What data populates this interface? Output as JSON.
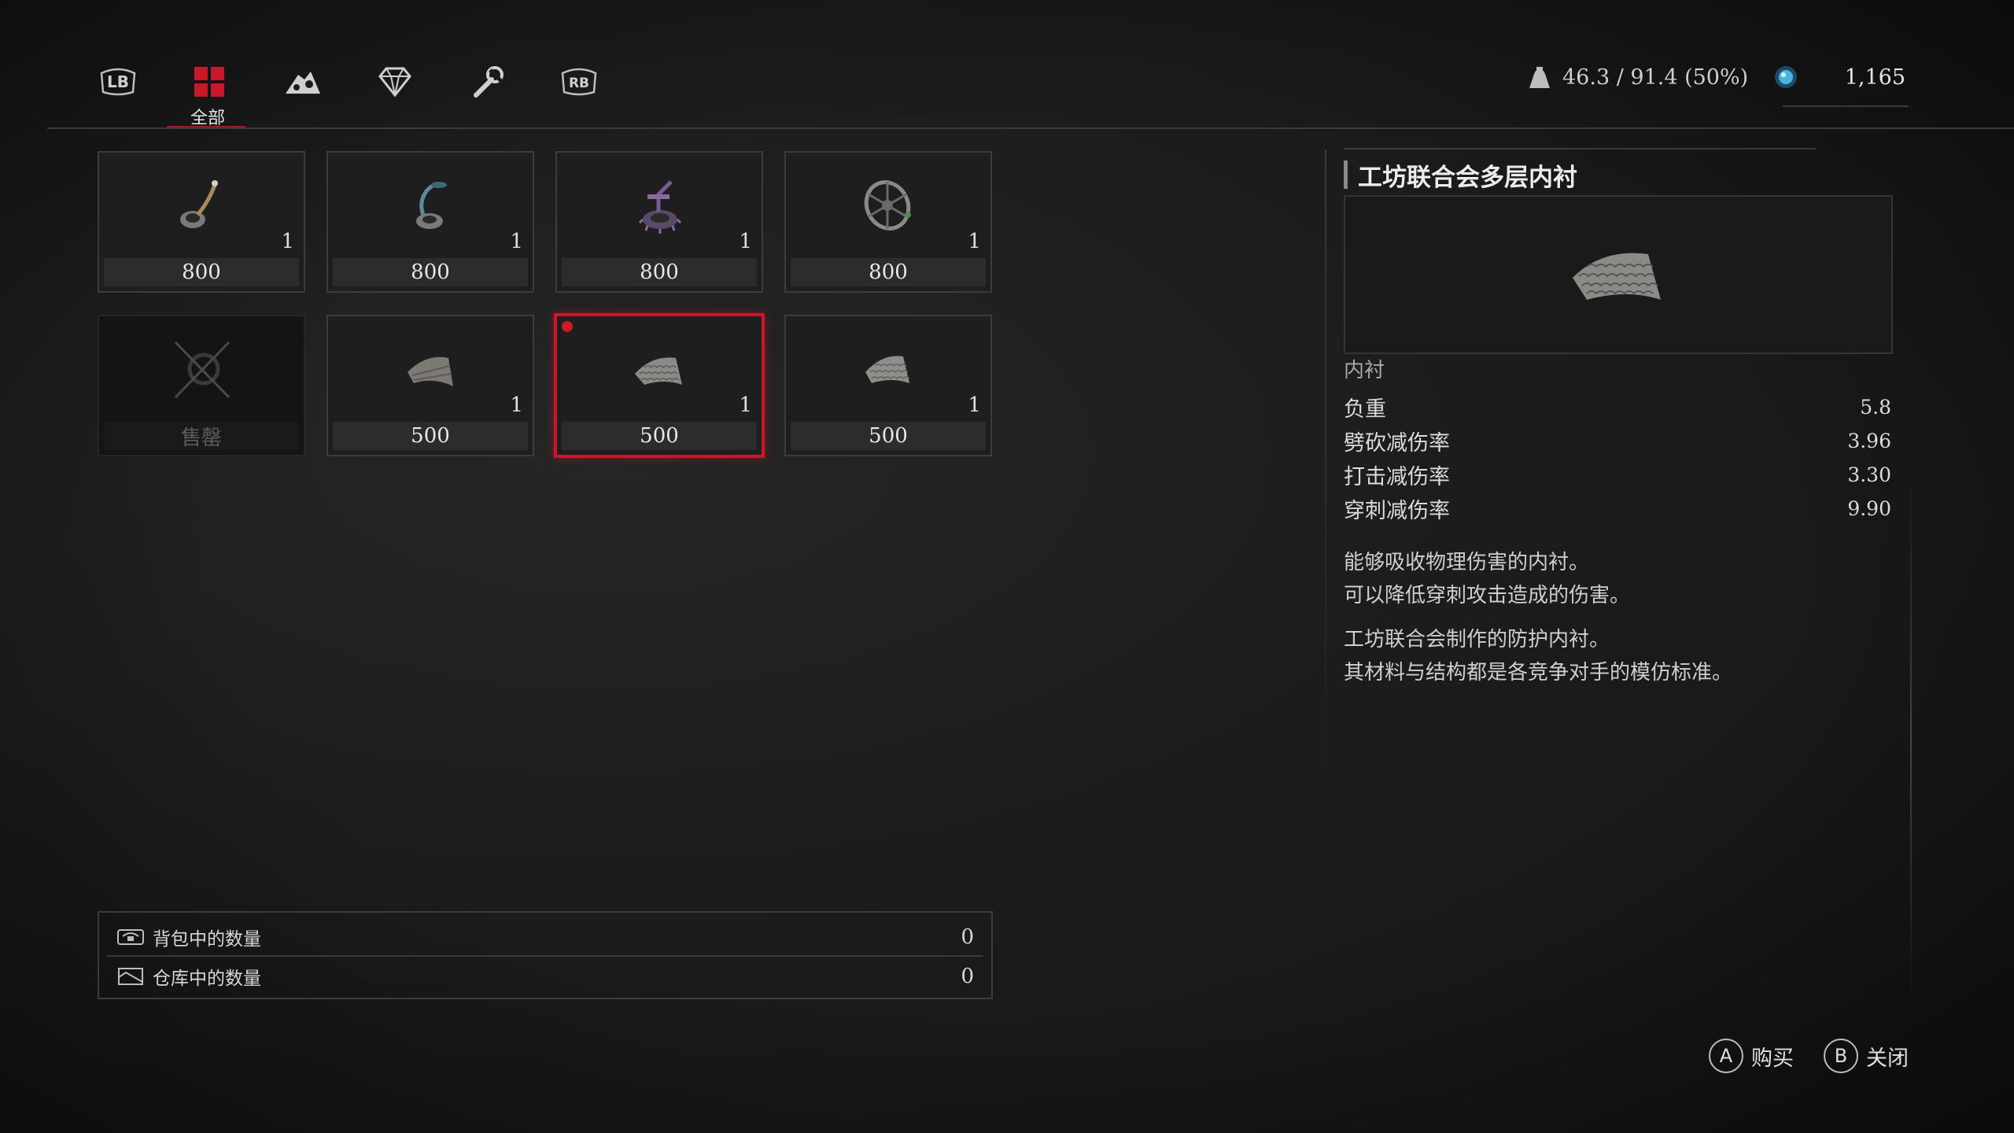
{
  "tabs": [
    {
      "name": "LB",
      "icon": "lb-shoulder-icon"
    },
    {
      "name": "全部",
      "icon": "all-grid-icon",
      "active": true
    },
    {
      "name": "",
      "icon": "cogs-pile-icon"
    },
    {
      "name": "",
      "icon": "gem-icon"
    },
    {
      "name": "",
      "icon": "wrench-icon"
    },
    {
      "name": "RB",
      "icon": "rb-shoulder-icon"
    }
  ],
  "header": {
    "weight_text": "46.3 / 91.4 (50%)",
    "currency_value": "1,165"
  },
  "items": [
    {
      "icon": "crank-amulet-icon",
      "qty": "1",
      "price": "800"
    },
    {
      "icon": "amulet-blue-icon",
      "qty": "1",
      "price": "800"
    },
    {
      "icon": "amulet-purple-gear-icon",
      "qty": "1",
      "price": "800"
    },
    {
      "icon": "wheel-amulet-icon",
      "qty": "1",
      "price": "800"
    },
    {
      "icon": "sold-out-icon",
      "qty": "",
      "price": "售罄",
      "sold": true
    },
    {
      "icon": "liner-plate-icon",
      "qty": "1",
      "price": "500"
    },
    {
      "icon": "liner-scale-icon",
      "qty": "1",
      "price": "500",
      "selected": true
    },
    {
      "icon": "liner-scale-icon",
      "qty": "1",
      "price": "500"
    }
  ],
  "counts": {
    "backpack_label": "背包中的数量",
    "backpack_value": "0",
    "storage_label": "仓库中的数量",
    "storage_value": "0"
  },
  "detail": {
    "title": "工坊联合会多层内衬",
    "category": "内衬",
    "stats": [
      {
        "label": "负重",
        "value": "5.8"
      },
      {
        "label": "劈砍减伤率",
        "value": "3.96"
      },
      {
        "label": "打击减伤率",
        "value": "3.30"
      },
      {
        "label": "穿刺减伤率",
        "value": "9.90"
      }
    ],
    "desc_1_line_1": "能够吸收物理伤害的内衬。",
    "desc_1_line_2": "可以降低穿刺攻击造成的伤害。",
    "desc_2_line_1": "工坊联合会制作的防护内衬。",
    "desc_2_line_2": "其材料与结构都是各竞争对手的模仿标准。"
  },
  "prompts": {
    "buy_key": "A",
    "buy_label": "购买",
    "close_key": "B",
    "close_label": "关闭"
  },
  "colors": {
    "accent_red": "#c8182a",
    "background": "#1c1c1c",
    "slot_border": "#3c3c3c"
  }
}
